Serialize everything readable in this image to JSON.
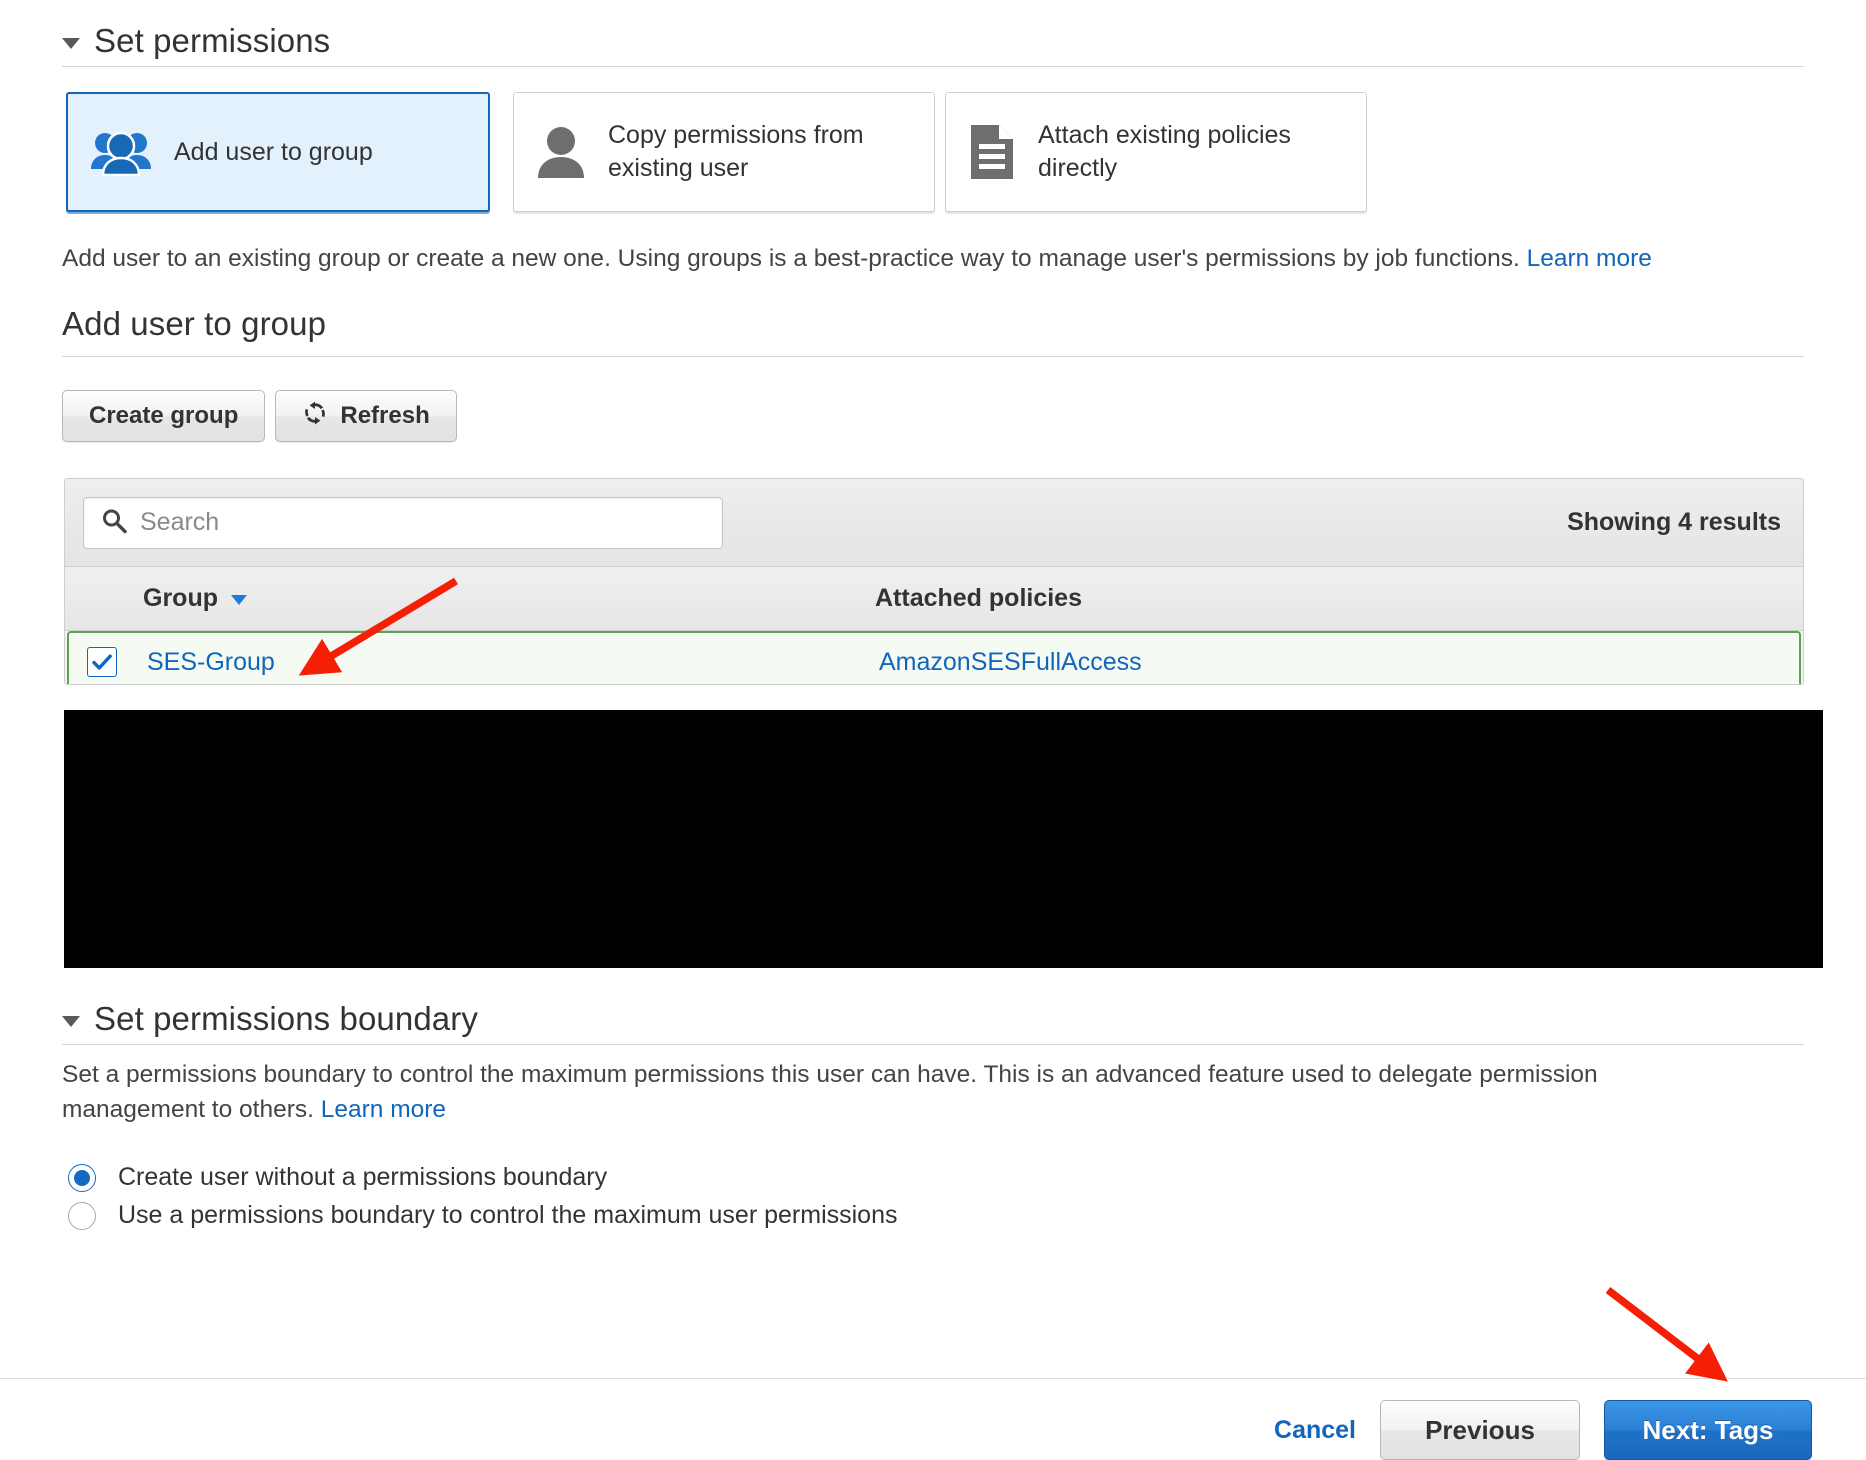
{
  "permissions_section": {
    "title": "Set permissions",
    "options": [
      {
        "label": "Add user to group",
        "icon": "users-group-icon",
        "selected": true
      },
      {
        "label": "Copy permissions from existing user",
        "icon": "user-icon",
        "selected": false
      },
      {
        "label": "Attach existing policies directly",
        "icon": "document-icon",
        "selected": false
      }
    ],
    "description": "Add user to an existing group or create a new one. Using groups is a best-practice way to manage user's permissions by job functions.",
    "learn_more": "Learn more"
  },
  "add_to_group": {
    "title": "Add user to group",
    "create_group_label": "Create group",
    "refresh_label": "Refresh",
    "refresh_icon": "refresh-icon",
    "search_placeholder": "Search",
    "search_value": "",
    "search_icon": "search-icon",
    "results_text": "Showing 4 results",
    "columns": [
      "Group",
      "Attached policies"
    ],
    "sort_column": "Group",
    "sort_icon": "chevron-down-icon",
    "rows": [
      {
        "checked": true,
        "group": "SES-Group",
        "policies": "AmazonSESFullAccess"
      }
    ]
  },
  "boundary_section": {
    "title": "Set permissions boundary",
    "description": "Set a permissions boundary to control the maximum permissions this user can have. This is an advanced feature used to delegate permission management to others.",
    "learn_more": "Learn more",
    "options": [
      {
        "label": "Create user without a permissions boundary",
        "selected": true
      },
      {
        "label": "Use a permissions boundary to control the maximum user permissions",
        "selected": false
      }
    ]
  },
  "footer": {
    "cancel_label": "Cancel",
    "previous_label": "Previous",
    "next_label": "Next: Tags"
  },
  "colors": {
    "accent_blue": "#1166bb",
    "primary_button": "#2a7fd4",
    "selected_card_bg": "#e3f1fc",
    "selected_row_border": "#5aa44e",
    "annotation_red": "#f51f06",
    "redaction": "#000000"
  }
}
